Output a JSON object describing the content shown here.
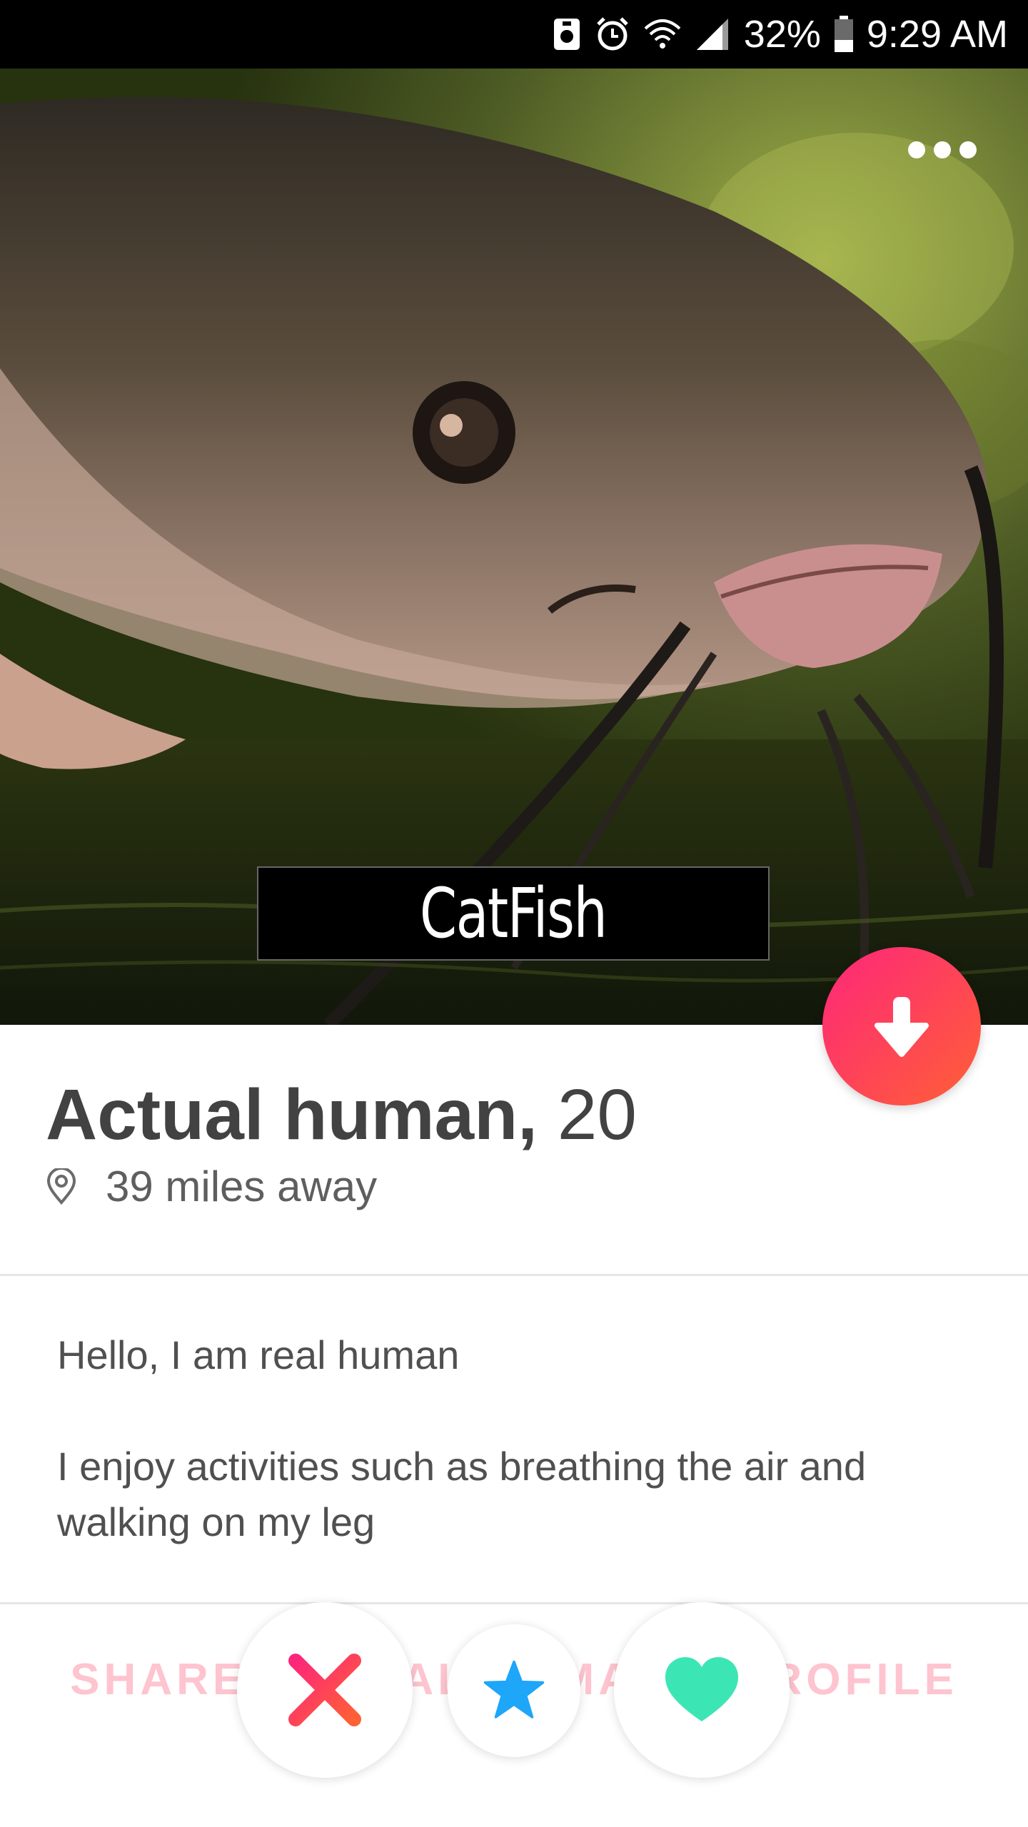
{
  "status_bar": {
    "battery": "32%",
    "time": "9:29 AM",
    "icons": [
      "sim-card-icon",
      "alarm-icon",
      "wifi-icon",
      "signal-icon",
      "battery-icon"
    ]
  },
  "photo": {
    "caption": "CatFish",
    "subject": "catfish"
  },
  "profile": {
    "name": "Actual human,",
    "age": "20",
    "distance": "39 miles away"
  },
  "bio": {
    "line1": "Hello, I am real human",
    "line2": "I enjoy activities such as breathing the air and walking on my leg"
  },
  "footer": {
    "share_label": "SHARE ACTUAL HUMAN'S PROFILE"
  },
  "actions": {
    "icons": [
      "nope-icon",
      "super-like-icon",
      "like-icon"
    ]
  },
  "colors": {
    "brand_gradient_start": "#fd267a",
    "brand_gradient_end": "#ff6036",
    "super_like": "#1ea6f9",
    "like": "#3ce6b4"
  }
}
